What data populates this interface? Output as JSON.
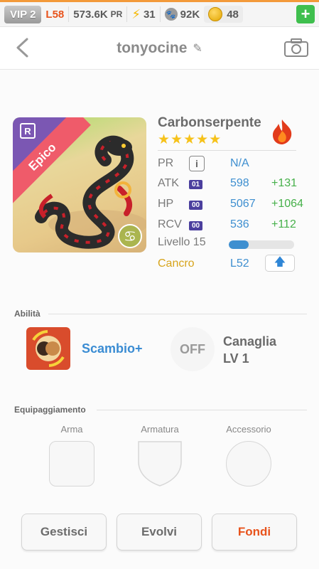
{
  "status_bar": {
    "vip": "VIP 2",
    "level": "L58",
    "power": "573.6K",
    "power_unit": "PR",
    "energy": "31",
    "paw_count": "92K",
    "coins": "48",
    "add_label": "+"
  },
  "header": {
    "username": "tonyocine"
  },
  "monster": {
    "name": "Carbonserpente",
    "rarity": "Epico",
    "rarity_badge": "R",
    "stars": "★★★★★",
    "stats": {
      "pr": {
        "label": "PR",
        "value": "N/A",
        "info": "i"
      },
      "atk": {
        "label": "ATK",
        "tag": "01",
        "value": "598",
        "bonus": "+131"
      },
      "hp": {
        "label": "HP",
        "tag": "00",
        "value": "5067",
        "bonus": "+1064"
      },
      "rcv": {
        "label": "RCV",
        "tag": "00",
        "value": "536",
        "bonus": "+112"
      }
    },
    "level_text": "Livello 15",
    "level_progress": 0.3,
    "sign": "Cancro",
    "sign_level": "L52",
    "zodiac_symbol": "♋"
  },
  "abilities": {
    "title": "Abilità",
    "active": {
      "name": "Scambio+"
    },
    "passive": {
      "state": "OFF",
      "name": "Canaglia",
      "level": "LV 1"
    }
  },
  "equipment": {
    "title": "Equipaggiamento",
    "slots": {
      "weapon": "Arma",
      "armor": "Armatura",
      "accessory": "Accessorio"
    }
  },
  "actions": {
    "manage": "Gestisci",
    "evolve": "Evolvi",
    "fuse": "Fondi"
  },
  "colors": {
    "accent_blue": "#3e8fd0",
    "bonus_green": "#46b04a",
    "orange": "#e8531c",
    "rarity_red": "#ef5b6a"
  }
}
